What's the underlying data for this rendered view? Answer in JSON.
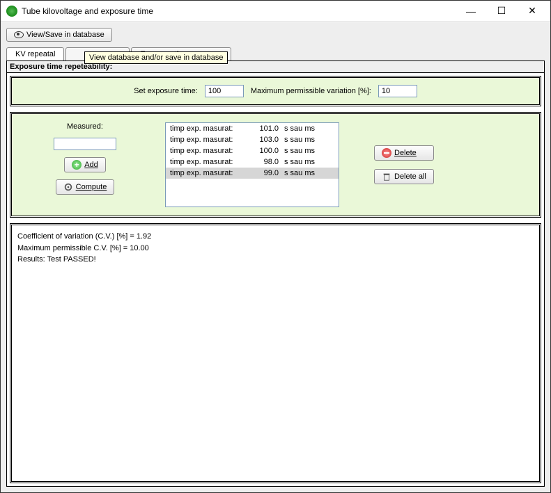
{
  "window": {
    "title": "Tube kilovoltage and exposure time"
  },
  "toolbar": {
    "view_save": "View/Save in database"
  },
  "tooltip": "View database and/or save in database",
  "tabs": {
    "t0": "KV repeatal",
    "t2suffix": "ccuracy",
    "t3": "Exposure time accuracy"
  },
  "section_title": "Exposure time repeteability:",
  "row": {
    "set_label": "Set exposure time:",
    "set_value": "100",
    "max_label": "Maximum permissible variation [%]:",
    "max_value": "10"
  },
  "measured_label": "Measured:",
  "measured_value": "",
  "buttons": {
    "add": "Add",
    "compute": "Compute",
    "delete": "Delete",
    "delete_all": "Delete all"
  },
  "list": [
    {
      "c1": "timp exp. masurat:",
      "c2": "101.0",
      "c3": "s sau ms",
      "sel": false
    },
    {
      "c1": "timp exp. masurat:",
      "c2": "103.0",
      "c3": "s sau ms",
      "sel": false
    },
    {
      "c1": "timp exp. masurat:",
      "c2": "100.0",
      "c3": "s sau ms",
      "sel": false
    },
    {
      "c1": "timp exp. masurat:",
      "c2": "98.0",
      "c3": "s sau ms",
      "sel": false
    },
    {
      "c1": "timp exp. masurat:",
      "c2": "99.0",
      "c3": "s sau ms",
      "sel": true
    }
  ],
  "results": {
    "l1": "Coefficient of variation (C.V.) [%] = 1.92",
    "l2": "Maximum permissible C.V. [%] = 10.00",
    "l3": "Results:  Test PASSED!"
  }
}
